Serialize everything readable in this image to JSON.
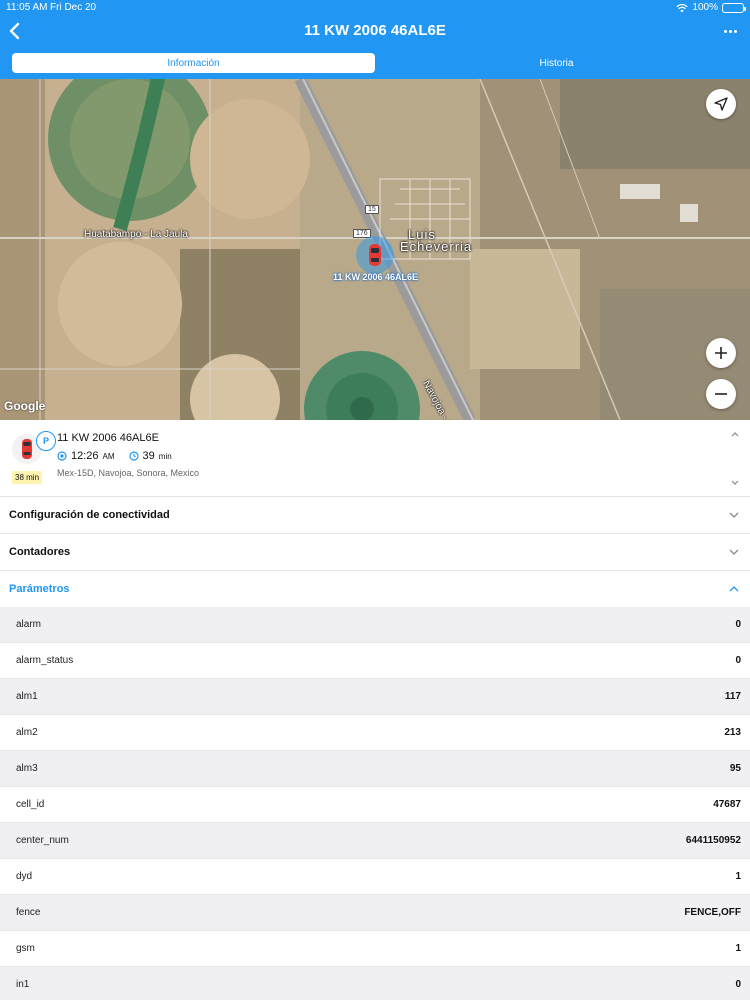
{
  "status_bar": {
    "time": "11:05 AM",
    "date": "Fri Dec 20",
    "battery": "100%"
  },
  "header": {
    "title": "11 KW 2006 46AL6E"
  },
  "tabs": [
    {
      "label": "Información",
      "active": true
    },
    {
      "label": "Historia",
      "active": false
    }
  ],
  "map": {
    "place_labels": {
      "huatabampo": "Huatabampo - La Jaula",
      "town_line1": "Luis",
      "town_line2": "Echeverria",
      "navojoa": "Navojoa - Los M"
    },
    "route_shields": {
      "r15": "15",
      "r176": "176"
    },
    "vehicle_label": "11 KW 2006 46AL6E",
    "provider": "Google"
  },
  "info": {
    "vehicle_name": "11 KW 2006 46AL6E",
    "status_badge": "P",
    "parked_time": "38 min",
    "last_time": "12:26",
    "last_time_suffix": "AM",
    "duration": "39",
    "duration_unit": "min",
    "address": "Mex-15D, Navojoa, Sonora, Mexico"
  },
  "sections": {
    "connectivity": "Configuración de conectividad",
    "counters": "Contadores",
    "parameters": "Parámetros"
  },
  "parameters": [
    {
      "key": "alarm",
      "value": "0"
    },
    {
      "key": "alarm_status",
      "value": "0"
    },
    {
      "key": "alm1",
      "value": "117"
    },
    {
      "key": "alm2",
      "value": "213"
    },
    {
      "key": "alm3",
      "value": "95"
    },
    {
      "key": "cell_id",
      "value": "47687"
    },
    {
      "key": "center_num",
      "value": "6441150952"
    },
    {
      "key": "dyd",
      "value": "1"
    },
    {
      "key": "fence",
      "value": "FENCE,OFF"
    },
    {
      "key": "gsm",
      "value": "1"
    },
    {
      "key": "in1",
      "value": "0"
    }
  ],
  "colors": {
    "accent": "#2196f3",
    "header_bg": "#2196f3",
    "chip_bg": "#fff3b0"
  }
}
